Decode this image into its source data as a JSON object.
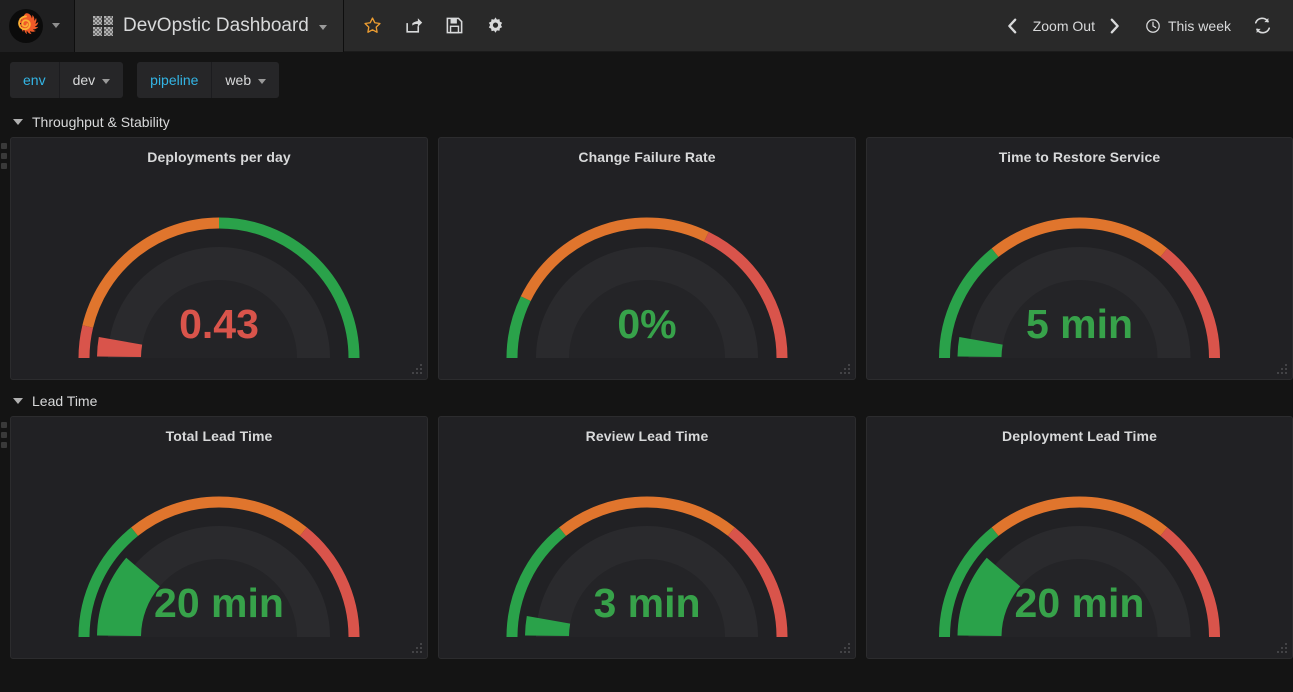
{
  "navbar": {
    "logo_icon": "grafana-logo-icon",
    "logo_caret_icon": "chevron-down-icon",
    "dashboard_icon": "dashboard-grid-icon",
    "title": "DevOpstic Dashboard",
    "title_caret_icon": "chevron-down-icon",
    "actions": [
      {
        "name": "star-icon",
        "label": "Mark as favorite"
      },
      {
        "name": "share-icon",
        "label": "Share dashboard"
      },
      {
        "name": "save-icon",
        "label": "Save dashboard"
      },
      {
        "name": "gear-icon",
        "label": "Dashboard settings"
      }
    ],
    "time_controls": {
      "prev_icon": "chevron-left-icon",
      "zoom_out_label": "Zoom Out",
      "next_icon": "chevron-right-icon",
      "clock_icon": "clock-icon",
      "range_label": "This week",
      "refresh_icon": "refresh-icon"
    }
  },
  "submenu": {
    "variables": [
      {
        "label": "env",
        "value": "dev",
        "caret_icon": "chevron-down-icon"
      },
      {
        "label": "pipeline",
        "value": "web",
        "caret_icon": "chevron-down-icon"
      }
    ]
  },
  "rows": [
    {
      "title": "Throughput & Stability",
      "collapse_icon": "chevron-down-icon",
      "panels": [
        {
          "title": "Deployments per day",
          "display_value": "0.43",
          "value_color": "#d9544b"
        },
        {
          "title": "Change Failure Rate",
          "display_value": "0%",
          "value_color": "#37a24a"
        },
        {
          "title": "Time to Restore Service",
          "display_value": "5 min",
          "value_color": "#37a24a"
        }
      ]
    },
    {
      "title": "Lead Time",
      "collapse_icon": "chevron-down-icon",
      "panels": [
        {
          "title": "Total Lead Time",
          "display_value": "20 min",
          "value_color": "#37a24a"
        },
        {
          "title": "Review Lead Time",
          "display_value": "3 min",
          "value_color": "#37a24a"
        },
        {
          "title": "Deployment Lead Time",
          "display_value": "20 min",
          "value_color": "#37a24a"
        }
      ]
    }
  ],
  "chart_data": {
    "type": "gauge",
    "title": "DevOpstic Dashboard — DORA metrics gauges",
    "palette": {
      "green": "#2aa24a",
      "orange": "#e0752d",
      "red": "#d9544b",
      "track": "#2e2e31",
      "panel_bg": "#212124",
      "page_bg": "#141414"
    },
    "gauges": [
      {
        "title": "Deployments per day",
        "display_value": "0.43",
        "value_color": "#d9544b",
        "value_fraction": 0.055,
        "value_band": "red",
        "thresholds": [
          {
            "color": "red",
            "from": 0.0,
            "to": 0.075
          },
          {
            "color": "orange",
            "from": 0.075,
            "to": 0.5
          },
          {
            "color": "green",
            "from": 0.5,
            "to": 1.0
          }
        ]
      },
      {
        "title": "Change Failure Rate",
        "display_value": "0%",
        "value_color": "#37a24a",
        "value_fraction": 0.0,
        "value_band": "green",
        "thresholds": [
          {
            "color": "green",
            "from": 0.0,
            "to": 0.145
          },
          {
            "color": "orange",
            "from": 0.145,
            "to": 0.645
          },
          {
            "color": "red",
            "from": 0.645,
            "to": 1.0
          }
        ]
      },
      {
        "title": "Time to Restore Service",
        "display_value": "5 min",
        "value_color": "#37a24a",
        "value_fraction": 0.055,
        "value_band": "green",
        "thresholds": [
          {
            "color": "green",
            "from": 0.0,
            "to": 0.285
          },
          {
            "color": "orange",
            "from": 0.285,
            "to": 0.715
          },
          {
            "color": "red",
            "from": 0.715,
            "to": 1.0
          }
        ]
      },
      {
        "title": "Total Lead Time",
        "display_value": "20 min",
        "value_color": "#37a24a",
        "value_fraction": 0.225,
        "value_band": "green",
        "thresholds": [
          {
            "color": "green",
            "from": 0.0,
            "to": 0.285
          },
          {
            "color": "orange",
            "from": 0.285,
            "to": 0.715
          },
          {
            "color": "red",
            "from": 0.715,
            "to": 1.0
          }
        ]
      },
      {
        "title": "Review Lead Time",
        "display_value": "3 min",
        "value_color": "#37a24a",
        "value_fraction": 0.055,
        "value_band": "green",
        "thresholds": [
          {
            "color": "green",
            "from": 0.0,
            "to": 0.285
          },
          {
            "color": "orange",
            "from": 0.285,
            "to": 0.715
          },
          {
            "color": "red",
            "from": 0.715,
            "to": 1.0
          }
        ]
      },
      {
        "title": "Deployment Lead Time",
        "display_value": "20 min",
        "value_color": "#37a24a",
        "value_fraction": 0.225,
        "value_band": "green",
        "thresholds": [
          {
            "color": "green",
            "from": 0.0,
            "to": 0.285
          },
          {
            "color": "orange",
            "from": 0.285,
            "to": 0.715
          },
          {
            "color": "red",
            "from": 0.715,
            "to": 1.0
          }
        ]
      }
    ]
  }
}
